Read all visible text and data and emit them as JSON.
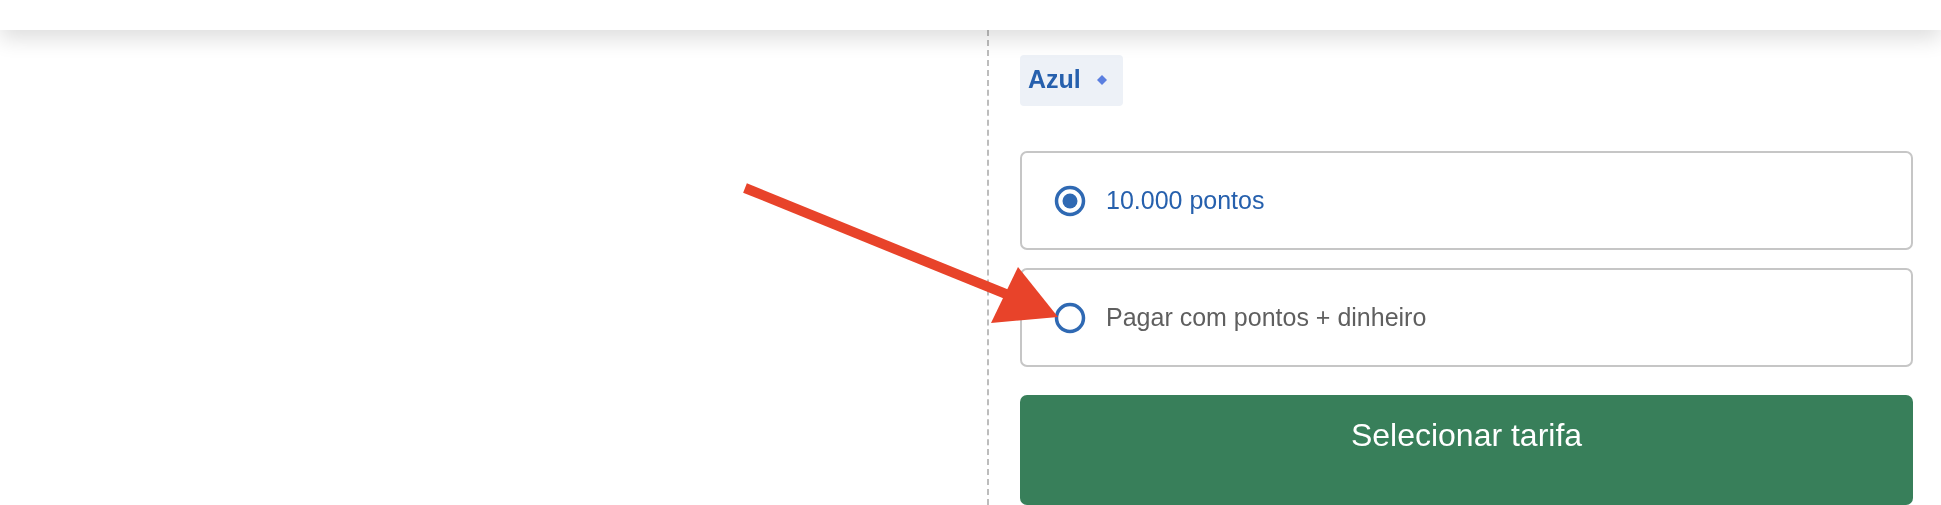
{
  "airline_tag": {
    "label": "Azul"
  },
  "fare_options": [
    {
      "label": "10.000 pontos",
      "selected": true
    },
    {
      "label": "Pagar com pontos + dinheiro",
      "selected": false
    }
  ],
  "select_button": {
    "label": "Selecionar tarifa"
  }
}
